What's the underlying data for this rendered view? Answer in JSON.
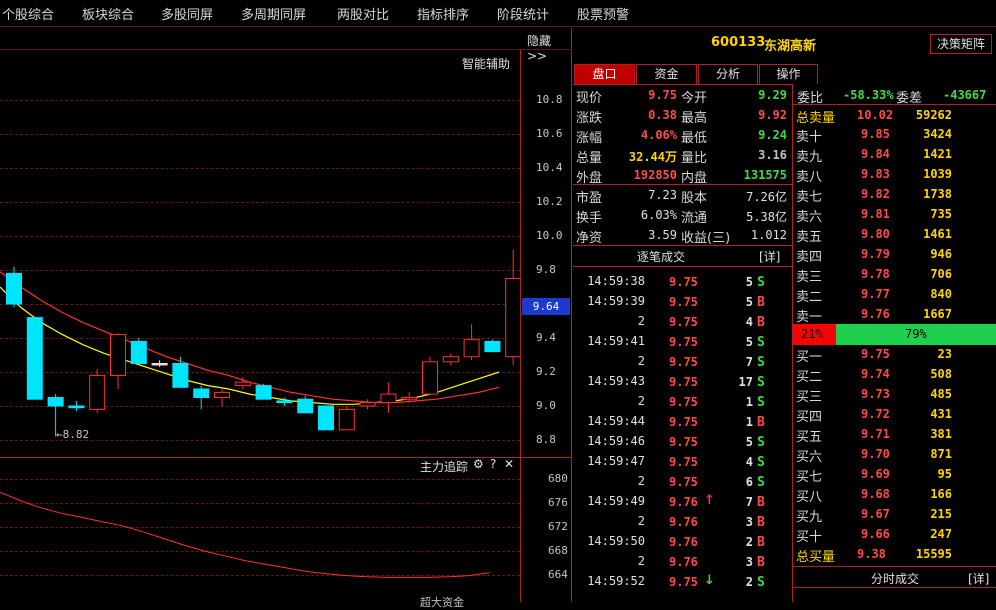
{
  "menu": [
    "个股综合",
    "板块综合",
    "多股同屏",
    "多周期同屏",
    "两股对比",
    "指标排序",
    "阶段统计",
    "股票预警"
  ],
  "chart_panel": {
    "hide_label": "隐藏>>",
    "smart_label": "智能辅助",
    "low_marker": "←8.82",
    "current_price_tag": "9.64",
    "main_axis": [
      "10.8",
      "10.6",
      "10.4",
      "10.2",
      "10.0",
      "9.8",
      "9.6",
      "9.4",
      "9.2",
      "9.0",
      "8.8"
    ],
    "sub_title": "主力追踪",
    "sub_icons": [
      "⚙",
      "?",
      "✕"
    ],
    "sub_axis": [
      "680",
      "676",
      "672",
      "668",
      "664"
    ],
    "bottom_cut": "超大资金"
  },
  "chart_data": {
    "type": "candlestick",
    "ylim": [
      8.7,
      10.95
    ],
    "candles": [
      {
        "o": 9.78,
        "c": 9.6,
        "h": 9.82,
        "l": 9.58,
        "dir": "down"
      },
      {
        "o": 9.52,
        "c": 9.04,
        "h": 9.52,
        "l": 9.04,
        "dir": "down"
      },
      {
        "o": 9.05,
        "c": 9.0,
        "h": 9.07,
        "l": 8.82,
        "dir": "down"
      },
      {
        "o": 8.99,
        "c": 9.0,
        "h": 9.03,
        "l": 8.97,
        "dir": "down"
      },
      {
        "o": 8.98,
        "c": 9.18,
        "h": 9.22,
        "l": 8.96,
        "dir": "up"
      },
      {
        "o": 9.18,
        "c": 9.42,
        "h": 9.43,
        "l": 9.1,
        "dir": "up"
      },
      {
        "o": 9.38,
        "c": 9.25,
        "h": 9.4,
        "l": 9.25,
        "dir": "down"
      },
      {
        "o": 9.25,
        "c": 9.25,
        "h": 9.27,
        "l": 9.23,
        "dir": "flat"
      },
      {
        "o": 9.25,
        "c": 9.11,
        "h": 9.29,
        "l": 9.11,
        "dir": "down"
      },
      {
        "o": 9.1,
        "c": 9.05,
        "h": 9.12,
        "l": 8.98,
        "dir": "down"
      },
      {
        "o": 9.05,
        "c": 9.08,
        "h": 9.1,
        "l": 9.0,
        "dir": "up"
      },
      {
        "o": 9.12,
        "c": 9.14,
        "h": 9.17,
        "l": 9.1,
        "dir": "up"
      },
      {
        "o": 9.12,
        "c": 9.04,
        "h": 9.13,
        "l": 9.04,
        "dir": "down"
      },
      {
        "o": 9.03,
        "c": 9.02,
        "h": 9.05,
        "l": 9.0,
        "dir": "down"
      },
      {
        "o": 9.04,
        "c": 8.96,
        "h": 9.06,
        "l": 8.96,
        "dir": "down"
      },
      {
        "o": 9.0,
        "c": 8.86,
        "h": 9.0,
        "l": 8.86,
        "dir": "down"
      },
      {
        "o": 8.98,
        "c": 8.86,
        "h": 9.0,
        "l": 8.86,
        "dir": "up"
      },
      {
        "o": 9.0,
        "c": 9.02,
        "h": 9.04,
        "l": 8.98,
        "dir": "up"
      },
      {
        "o": 9.02,
        "c": 9.07,
        "h": 9.14,
        "l": 8.96,
        "dir": "up"
      },
      {
        "o": 9.05,
        "c": 9.04,
        "h": 9.08,
        "l": 9.02,
        "dir": "up"
      },
      {
        "o": 9.07,
        "c": 9.26,
        "h": 9.29,
        "l": 9.06,
        "dir": "up"
      },
      {
        "o": 9.26,
        "c": 9.29,
        "h": 9.31,
        "l": 9.24,
        "dir": "up"
      },
      {
        "o": 9.29,
        "c": 9.39,
        "h": 9.48,
        "l": 9.27,
        "dir": "up"
      },
      {
        "o": 9.38,
        "c": 9.32,
        "h": 9.39,
        "l": 9.32,
        "dir": "down"
      },
      {
        "o": 9.29,
        "c": 9.75,
        "h": 9.92,
        "l": 9.24,
        "dir": "up"
      }
    ],
    "ma_series": [
      {
        "color": "#ffff00",
        "values": [
          9.7,
          9.58,
          9.49,
          9.42,
          9.36,
          9.31,
          9.27,
          9.23,
          9.19,
          9.15,
          9.12,
          9.1,
          9.07,
          9.05,
          9.03,
          9.02,
          9.01,
          9.01,
          9.02,
          9.03,
          9.05,
          9.08,
          9.12,
          9.16,
          9.2
        ]
      },
      {
        "color": "#ff3030",
        "values": [
          9.79,
          9.7,
          9.62,
          9.55,
          9.49,
          9.44,
          9.39,
          9.34,
          9.29,
          9.25,
          9.21,
          9.18,
          9.14,
          9.11,
          9.08,
          9.06,
          9.04,
          9.03,
          9.02,
          9.02,
          9.03,
          9.04,
          9.06,
          9.08,
          9.11
        ]
      }
    ],
    "sub_ylim": [
      662,
      682
    ],
    "sub_series": [
      {
        "color": "#ff3030",
        "values": [
          677.8,
          676.4,
          675.2,
          674.3,
          673.6,
          672.9,
          672.2,
          671.2,
          670.1,
          669.0,
          668.0,
          667.2,
          666.4,
          665.8,
          665.2,
          664.6,
          664.2,
          663.9,
          663.7,
          663.6,
          663.6,
          663.6,
          663.7,
          663.9,
          664.4
        ]
      }
    ]
  },
  "quote": {
    "code": "600133",
    "name": "东湖高新",
    "decision_btn": "决策矩阵",
    "tabs": [
      "盘口",
      "资金",
      "分析",
      "操作"
    ],
    "fields": [
      {
        "l1": "现价",
        "v1": "9.75",
        "c1": "red",
        "l2": "今开",
        "v2": "9.29",
        "c2": "green"
      },
      {
        "l1": "涨跌",
        "v1": "0.38",
        "c1": "red",
        "l2": "最高",
        "v2": "9.92",
        "c2": "red"
      },
      {
        "l1": "涨幅",
        "v1": "4.06%",
        "c1": "red",
        "l2": "最低",
        "v2": "9.24",
        "c2": "green"
      },
      {
        "l1": "总量",
        "v1": "32.44万",
        "c1": "yellow",
        "l2": "量比",
        "v2": "3.16",
        "c2": "grey"
      },
      {
        "l1": "外盘",
        "v1": "192850",
        "c1": "red",
        "l2": "内盘",
        "v2": "131575",
        "c2": "green"
      }
    ],
    "fields2": [
      {
        "l1": "市盈",
        "v1": "7.23",
        "l2": "股本",
        "v2": "7.26亿"
      },
      {
        "l1": "换手",
        "v1": "6.03%",
        "l2": "流通",
        "v2": "5.38亿"
      },
      {
        "l1": "净资",
        "v1": "3.59",
        "l2": "收益(三)",
        "v2": "1.012"
      }
    ],
    "ticks_title": "逐笔成交",
    "ticks_detail": "[详]",
    "ticks": [
      {
        "t": "14:59:38",
        "p": "9.75",
        "q": "5",
        "d": "S",
        "arrow": ""
      },
      {
        "t": "14:59:39",
        "p": "9.75",
        "q": "5",
        "d": "B",
        "arrow": ""
      },
      {
        "t": "2",
        "p": "9.75",
        "q": "4",
        "d": "B",
        "arrow": ""
      },
      {
        "t": "14:59:41",
        "p": "9.75",
        "q": "5",
        "d": "S",
        "arrow": ""
      },
      {
        "t": "2",
        "p": "9.75",
        "q": "7",
        "d": "S",
        "arrow": ""
      },
      {
        "t": "14:59:43",
        "p": "9.75",
        "q": "17",
        "d": "S",
        "arrow": ""
      },
      {
        "t": "2",
        "p": "9.75",
        "q": "1",
        "d": "S",
        "arrow": ""
      },
      {
        "t": "14:59:44",
        "p": "9.75",
        "q": "1",
        "d": "B",
        "arrow": ""
      },
      {
        "t": "14:59:46",
        "p": "9.75",
        "q": "5",
        "d": "S",
        "arrow": ""
      },
      {
        "t": "14:59:47",
        "p": "9.75",
        "q": "4",
        "d": "S",
        "arrow": ""
      },
      {
        "t": "2",
        "p": "9.75",
        "q": "6",
        "d": "S",
        "arrow": ""
      },
      {
        "t": "14:59:49",
        "p": "9.76",
        "q": "7",
        "d": "B",
        "arrow": "↑"
      },
      {
        "t": "2",
        "p": "9.76",
        "q": "3",
        "d": "B",
        "arrow": ""
      },
      {
        "t": "14:59:50",
        "p": "9.76",
        "q": "2",
        "d": "B",
        "arrow": ""
      },
      {
        "t": "2",
        "p": "9.76",
        "q": "3",
        "d": "B",
        "arrow": ""
      },
      {
        "t": "14:59:52",
        "p": "9.75",
        "q": "2",
        "d": "S",
        "arrow": "↓"
      }
    ],
    "weibi_label": "委比",
    "weibi_value": "-58.33%",
    "weicha_label": "委差",
    "weicha_value": "-43667",
    "total_sell": {
      "label": "总卖量",
      "p": "10.02",
      "v": "59262"
    },
    "asks": [
      {
        "l": "卖十",
        "p": "9.85",
        "v": "3424"
      },
      {
        "l": "卖九",
        "p": "9.84",
        "v": "1421"
      },
      {
        "l": "卖八",
        "p": "9.83",
        "v": "1039"
      },
      {
        "l": "卖七",
        "p": "9.82",
        "v": "1738"
      },
      {
        "l": "卖六",
        "p": "9.81",
        "v": "735"
      },
      {
        "l": "卖五",
        "p": "9.80",
        "v": "1461"
      },
      {
        "l": "卖四",
        "p": "9.79",
        "v": "946"
      },
      {
        "l": "卖三",
        "p": "9.78",
        "v": "706"
      },
      {
        "l": "卖二",
        "p": "9.77",
        "v": "840"
      },
      {
        "l": "卖一",
        "p": "9.76",
        "v": "1667"
      }
    ],
    "ratio": {
      "sell_pct": "21%",
      "buy_pct": "79%",
      "buy_fraction": 0.79
    },
    "bids": [
      {
        "l": "买一",
        "p": "9.75",
        "v": "23"
      },
      {
        "l": "买二",
        "p": "9.74",
        "v": "508"
      },
      {
        "l": "买三",
        "p": "9.73",
        "v": "485"
      },
      {
        "l": "买四",
        "p": "9.72",
        "v": "431"
      },
      {
        "l": "买五",
        "p": "9.71",
        "v": "381"
      },
      {
        "l": "买六",
        "p": "9.70",
        "v": "871"
      },
      {
        "l": "买七",
        "p": "9.69",
        "v": "95"
      },
      {
        "l": "买八",
        "p": "9.68",
        "v": "166"
      },
      {
        "l": "买九",
        "p": "9.67",
        "v": "215"
      },
      {
        "l": "买十",
        "p": "9.66",
        "v": "247"
      }
    ],
    "total_buy": {
      "label": "总买量",
      "p": "9.38",
      "v": "15595"
    },
    "minute_title": "分时成交",
    "minute_detail": "[详]"
  },
  "colors": {
    "up": "#ff3030",
    "down": "#00e5ff",
    "accent_bg": "#ff0000",
    "green_bar": "#1fd04f"
  }
}
